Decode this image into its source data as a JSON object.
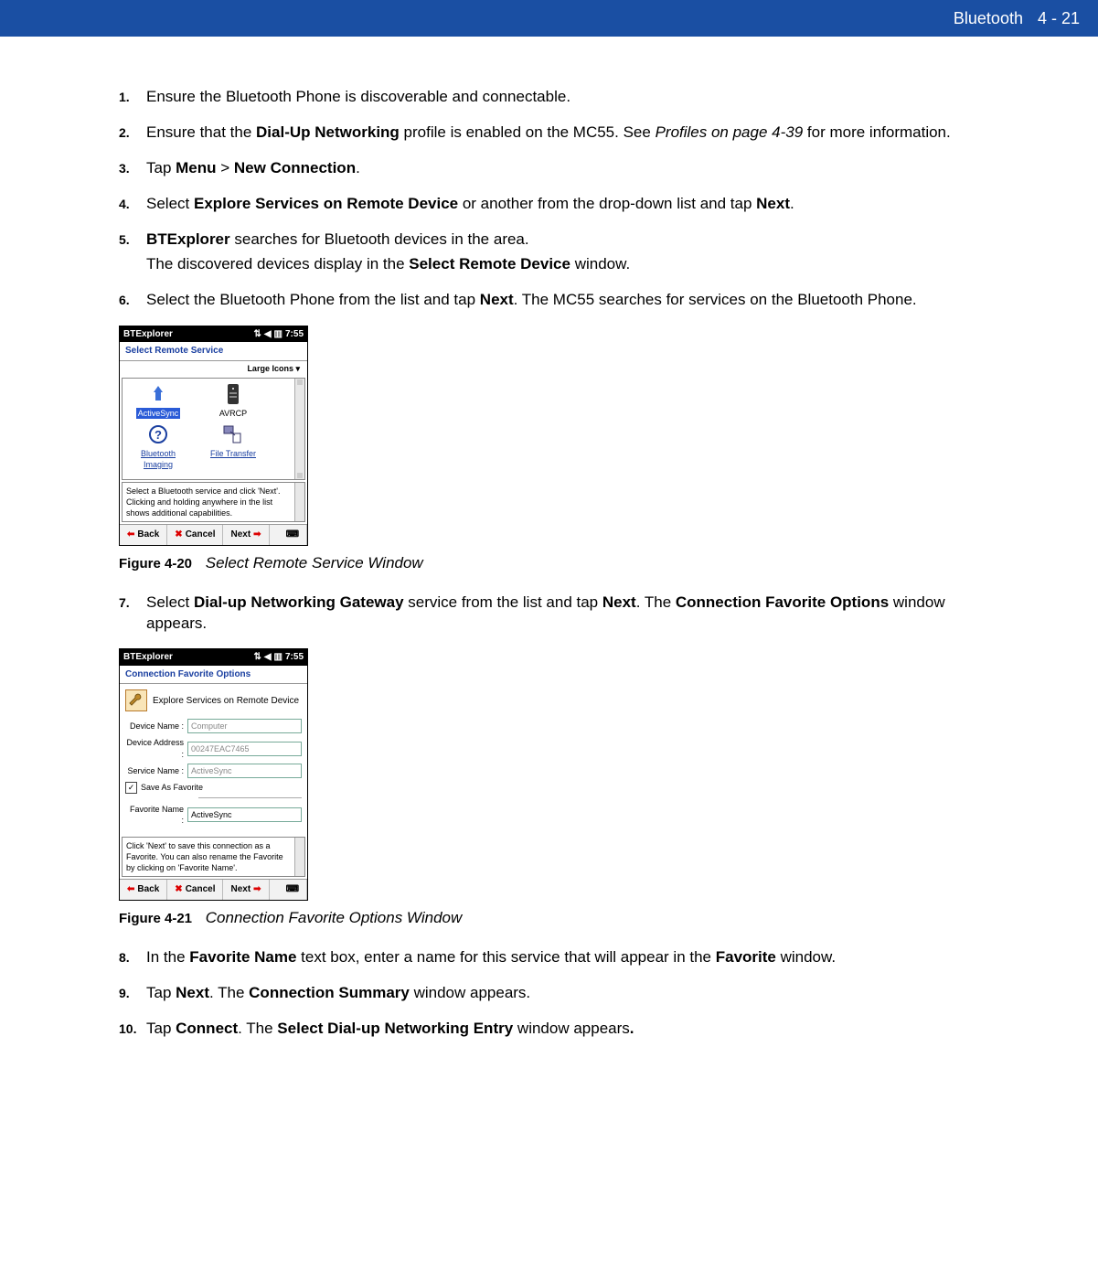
{
  "header": {
    "chapter": "Bluetooth",
    "page": "4 - 21"
  },
  "steps": {
    "s1": {
      "num": "1.",
      "text_a": "Ensure the Bluetooth Phone is discoverable and connectable."
    },
    "s2": {
      "num": "2.",
      "t1": "Ensure that the ",
      "b1": "Dial-Up Networking",
      "t2": " profile is enabled on the MC55. See ",
      "i1": "Profiles on page 4-39",
      "t3": " for more information."
    },
    "s3": {
      "num": "3.",
      "t1": "Tap ",
      "b1": "Menu",
      "t2": " > ",
      "b2": "New Connection",
      "t3": "."
    },
    "s4": {
      "num": "4.",
      "t1": "Select ",
      "b1": "Explore Services on Remote Device",
      "t2": " or another from the drop-down list and tap ",
      "b2": "Next",
      "t3": "."
    },
    "s5": {
      "num": "5.",
      "b1": "BTExplorer",
      "t1": " searches for Bluetooth devices in the area.",
      "sub_t1": "The discovered devices display in the ",
      "sub_b1": "Select Remote Device",
      "sub_t2": " window."
    },
    "s6": {
      "num": "6.",
      "t1": "Select the Bluetooth Phone from the list and tap ",
      "b1": "Next",
      "t2": ". The MC55 searches for services on the Bluetooth Phone."
    },
    "s7": {
      "num": "7.",
      "t1": "Select ",
      "b1": "Dial-up Networking Gateway",
      "t2": " service from the list and tap ",
      "b2": "Next",
      "t3": ". The ",
      "b3": "Connection Favorite Options",
      "t4": " window appears."
    },
    "s8": {
      "num": "8.",
      "t1": "In the ",
      "b1": "Favorite Name",
      "t2": " text box, enter a name for this service that will appear in the ",
      "b2": "Favorite",
      "t3": " window."
    },
    "s9": {
      "num": "9.",
      "t1": "Tap ",
      "b1": "Next",
      "t2": ". The ",
      "b2": "Connection Summary",
      "t3": " window appears."
    },
    "s10": {
      "num": "10.",
      "t1": "Tap ",
      "b1": "Connect",
      "t2": ". The ",
      "b2": "Select Dial-up Networking Entry",
      "t3": " window appears",
      "b3": "."
    }
  },
  "fig1": {
    "label": "Figure 4-20",
    "caption": "Select Remote Service Window",
    "titlebar": "BTExplorer",
    "time": "7:55",
    "subtitle": "Select Remote Service",
    "view": "Large Icons",
    "items": {
      "0": {
        "label": "ActiveSync"
      },
      "1": {
        "label": "AVRCP"
      },
      "2": {
        "label": "Bluetooth Imaging"
      },
      "3": {
        "label": "File Transfer"
      }
    },
    "hint": "Select a Bluetooth service and click 'Next'. Clicking and holding anywhere in the list shows additional capabilities.",
    "buttons": {
      "back": "Back",
      "cancel": "Cancel",
      "next": "Next"
    }
  },
  "fig2": {
    "label": "Figure 4-21",
    "caption": "Connection Favorite Options Window",
    "titlebar": "BTExplorer",
    "time": "7:55",
    "subtitle": "Connection Favorite Options",
    "action": "Explore Services on Remote Device",
    "labels": {
      "device_name": "Device Name :",
      "device_address": "Device Address :",
      "service_name": "Service Name :",
      "save_as": "Save As Favorite",
      "favorite_name": "Favorite Name :"
    },
    "values": {
      "device_name": "Computer",
      "device_address": "00247EAC7465",
      "service_name": "ActiveSync",
      "favorite_name": "ActiveSync"
    },
    "hint": "Click 'Next' to save this connection as a Favorite.  You can also rename the Favorite by clicking on 'Favorite Name'.",
    "buttons": {
      "back": "Back",
      "cancel": "Cancel",
      "next": "Next"
    }
  }
}
